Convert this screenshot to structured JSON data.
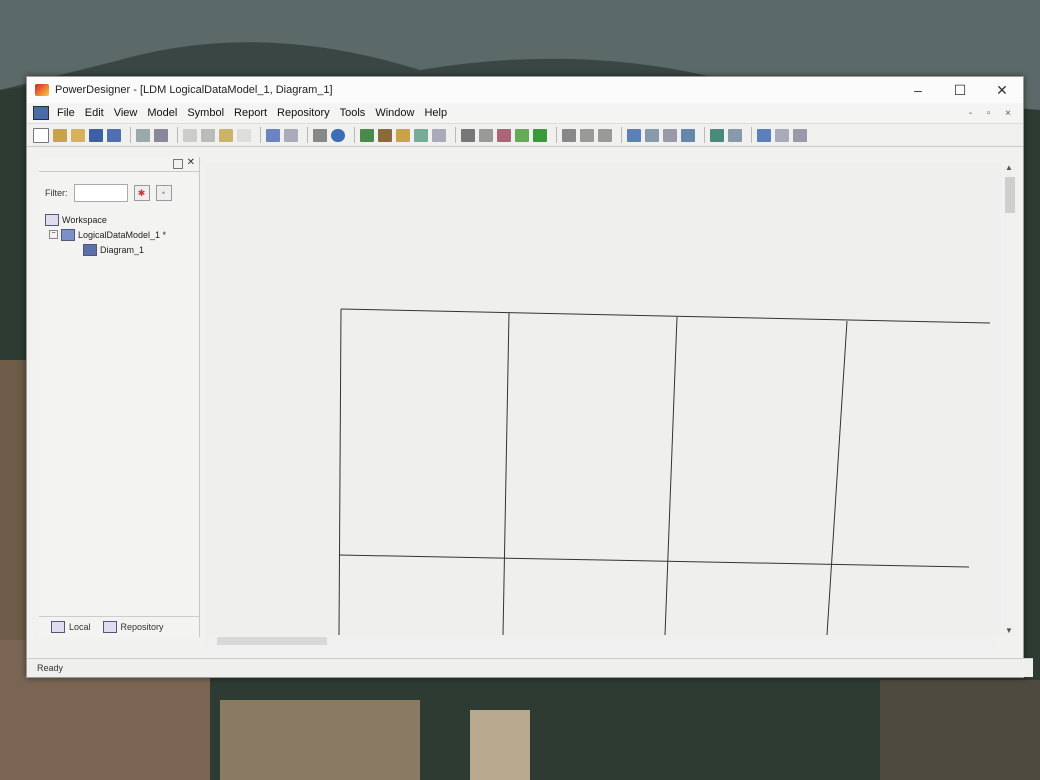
{
  "window": {
    "title": "PowerDesigner - [LDM LogicalDataModel_1, Diagram_1]",
    "controls": [
      "–",
      "☐",
      "✕"
    ]
  },
  "menu": [
    {
      "label": "File"
    },
    {
      "label": "Edit"
    },
    {
      "label": "View"
    },
    {
      "label": "Model"
    },
    {
      "label": "Symbol"
    },
    {
      "label": "Report"
    },
    {
      "label": "Repository"
    },
    {
      "label": "Tools"
    },
    {
      "label": "Window"
    },
    {
      "label": "Help"
    }
  ],
  "mdi_controls": "- ▫ ×",
  "browser": {
    "filter_label": "Filter:",
    "filter_value": "",
    "tree": [
      {
        "label": "Workspace"
      },
      {
        "label": "LogicalDataModel_1 *"
      },
      {
        "label": "Diagram_1"
      }
    ],
    "tabs": [
      {
        "label": "Local"
      },
      {
        "label": "Repository"
      }
    ]
  },
  "status": {
    "text": "Ready"
  }
}
